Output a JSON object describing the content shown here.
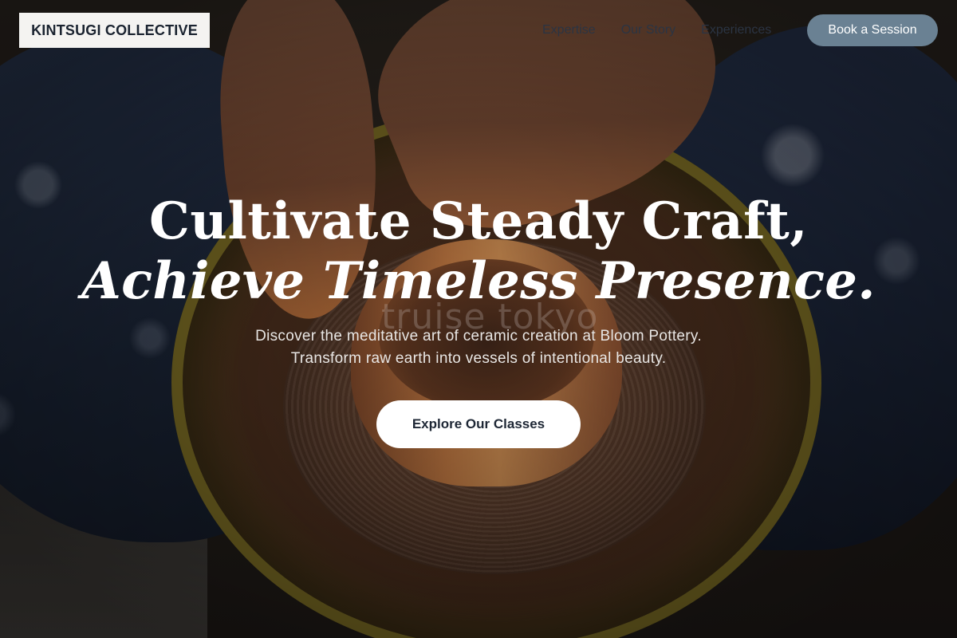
{
  "nav": {
    "logo": "KINTSUGI COLLECTIVE",
    "links": [
      {
        "label": "Expertise"
      },
      {
        "label": "Our Story"
      },
      {
        "label": "Experiences"
      }
    ],
    "cta": "Book a Session"
  },
  "hero": {
    "title_line1": "Cultivate Steady Craft,",
    "title_line2": "Achieve Timeless Presence.",
    "subtitle_line1": "Discover the meditative art of ceramic creation at Bloom Pottery.",
    "subtitle_line2": "Transform raw earth into vessels of intentional beauty.",
    "cta": "Explore Our Classes",
    "watermark": "truise tokyo"
  },
  "colors": {
    "book_button_bg": "#6a8193",
    "logo_bg": "#f4f3f1",
    "cta_bg": "#ffffff",
    "text_dark": "#1e2735"
  }
}
